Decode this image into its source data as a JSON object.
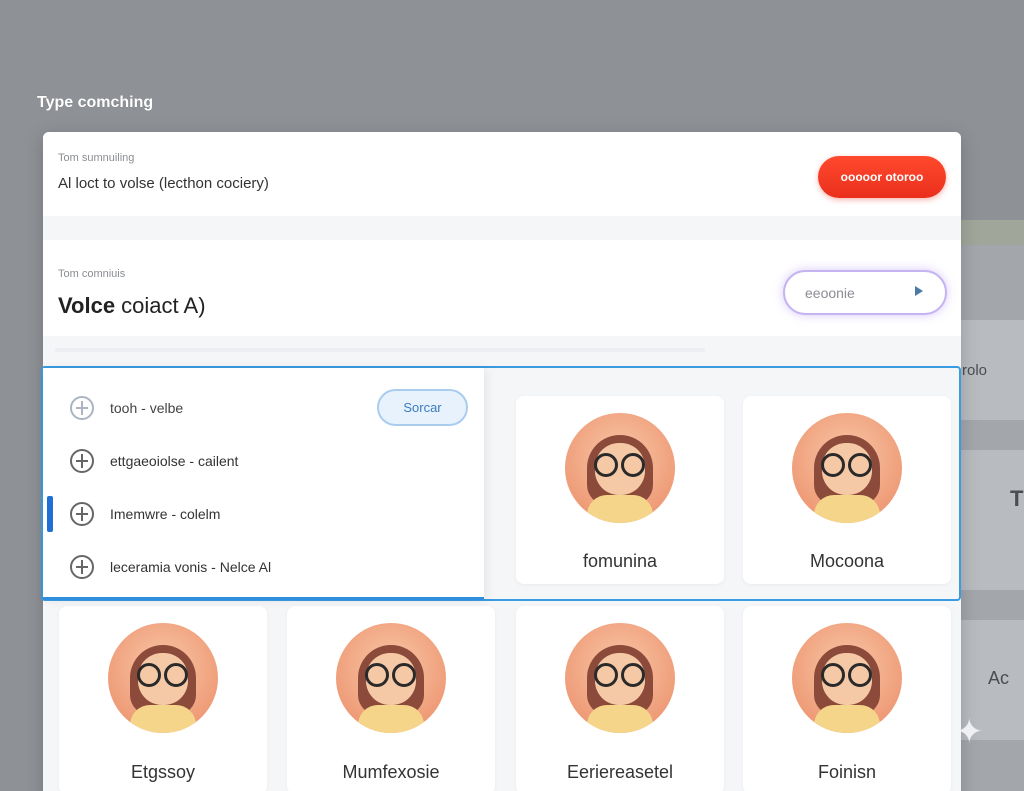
{
  "page_label": "Type comching",
  "row1": {
    "label": "Tom sumnuiling",
    "value": "Al loct to volse (lecthon cociery)",
    "button": "ooooor otoroo"
  },
  "row2": {
    "label": "Tom comniuis",
    "value_bold": "Volce",
    "value_rest": " coiact A)",
    "button": "eeoonie"
  },
  "dropdown": {
    "items": [
      {
        "label": "tooh - velbe"
      },
      {
        "label": "ettgaeoiolse - cailent"
      },
      {
        "label": "Imemwre - colelm"
      },
      {
        "label": "leceramia vonis - Nelce Al"
      }
    ],
    "pill_button": "Sorcar"
  },
  "background": {
    "right_text_1": "rolo",
    "right_text_2": "T",
    "right_text_3": "Ac"
  },
  "cards": [
    {
      "name": "fomunina"
    },
    {
      "name": "Mocoona"
    },
    {
      "name": "Etgssoy"
    },
    {
      "name": "Mumfexosie"
    },
    {
      "name": "Eeriereasetel"
    },
    {
      "name": "Foinisn"
    }
  ],
  "colors": {
    "accent_red": "#ea2f1c",
    "accent_blue": "#2e8fe0",
    "accent_purple": "#c6b4f2"
  }
}
